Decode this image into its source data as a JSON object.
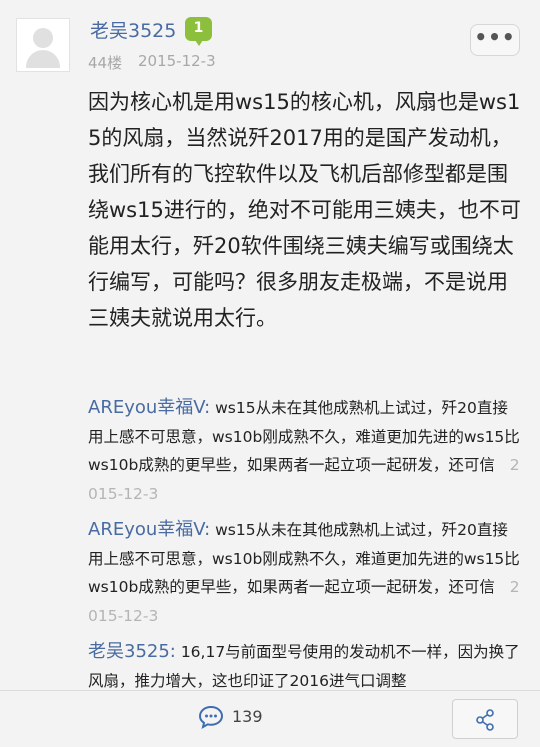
{
  "post": {
    "username": "老吴3525",
    "level": "1",
    "floor": "44楼",
    "date": "2015-12-3",
    "more_label": "•••",
    "body": "因为核心机是用ws15的核心机，风扇也是ws15的风扇，当然说歼2017用的是国产发动机，我们所有的飞控软件以及飞机后部修型都是围绕ws15进行的，绝对不可能用三姨夫，也不可能用太行，歼20软件围绕三姨夫编写或围绕太行编写，可能吗？很多朋友走极端，不是说用三姨夫就说用太行。"
  },
  "comments": [
    {
      "author": "AREyou幸福V:",
      "text": "ws15从未在其他成熟机上试过，歼20直接用上感不可思意，ws10b刚成熟不久，难道更加先进的ws15比ws10b成熟的更早些，如果两者一起立项一起研发，还可信",
      "date": "2015-12-3"
    },
    {
      "author": "AREyou幸福V:",
      "text": "ws15从未在其他成熟机上试过，歼20直接用上感不可思意，ws10b刚成熟不久，难道更加先进的ws15比ws10b成熟的更早些，如果两者一起立项一起研发，还可信",
      "date": "2015-12-3"
    },
    {
      "author": "老吴3525:",
      "text": "16,17与前面型号使用的发动机不一样，因为换了风扇，推力增大，这也印证了2016进气口调整",
      "date": ""
    }
  ],
  "bottom_bar": {
    "comment_count": "139"
  },
  "icons": {
    "comment": "speech-bubble-icon",
    "share": "share-icon",
    "more": "more-dots-icon"
  },
  "colors": {
    "username": "#4a6ba1",
    "badge": "#8bbf3c",
    "meta": "#a8a8a8"
  }
}
